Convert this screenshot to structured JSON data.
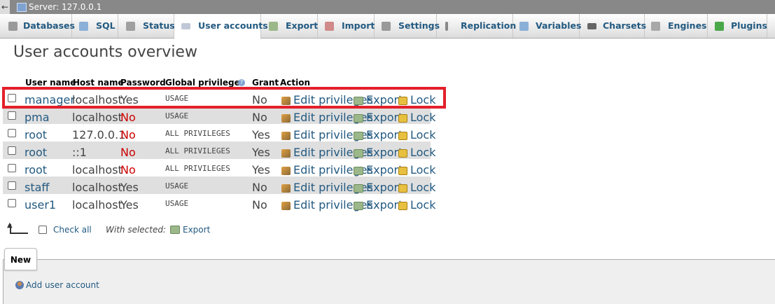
{
  "topbar": {
    "back": "←",
    "server_label": "Server: 127.0.0.1"
  },
  "tabs": [
    {
      "label": "Databases",
      "icon": "databases-icon"
    },
    {
      "label": "SQL",
      "icon": "sql-icon"
    },
    {
      "label": "Status",
      "icon": "status-icon"
    },
    {
      "label": "User accounts",
      "icon": "user-accounts-icon",
      "active": true
    },
    {
      "label": "Export",
      "icon": "export-icon"
    },
    {
      "label": "Import",
      "icon": "import-icon"
    },
    {
      "label": "Settings",
      "icon": "settings-icon"
    },
    {
      "label": "Replication",
      "icon": "replication-icon"
    },
    {
      "label": "Variables",
      "icon": "variables-icon"
    },
    {
      "label": "Charsets",
      "icon": "charsets-icon"
    },
    {
      "label": "Engines",
      "icon": "engines-icon"
    },
    {
      "label": "Plugins",
      "icon": "plugins-icon"
    }
  ],
  "page_title": "User accounts overview",
  "table": {
    "headers": {
      "user": "User name",
      "host": "Host name",
      "password": "Password",
      "privs": "Global privileges",
      "grant": "Grant",
      "action": "Action"
    },
    "rows": [
      {
        "user": "manager",
        "host": "localhost",
        "password": "Yes",
        "privs": "USAGE",
        "grant": "No"
      },
      {
        "user": "pma",
        "host": "localhost",
        "password": "No",
        "privs": "USAGE",
        "grant": "No"
      },
      {
        "user": "root",
        "host": "127.0.0.1",
        "password": "No",
        "privs": "ALL PRIVILEGES",
        "grant": "Yes"
      },
      {
        "user": "root",
        "host": "::1",
        "password": "No",
        "privs": "ALL PRIVILEGES",
        "grant": "Yes"
      },
      {
        "user": "root",
        "host": "localhost",
        "password": "No",
        "privs": "ALL PRIVILEGES",
        "grant": "Yes"
      },
      {
        "user": "staff",
        "host": "localhost",
        "password": "Yes",
        "privs": "USAGE",
        "grant": "No"
      },
      {
        "user": "user1",
        "host": "localhost",
        "password": "Yes",
        "privs": "USAGE",
        "grant": "No"
      }
    ],
    "actions": {
      "edit": "Edit privileges",
      "export": "Export",
      "lock": "Lock"
    }
  },
  "bulk": {
    "check_all": "Check all",
    "with_selected": "With selected:",
    "export": "Export"
  },
  "new_section": {
    "tab_label": "New",
    "add_user": "Add user account"
  },
  "colors": {
    "link": "#235a81",
    "highlight": "#e3202a",
    "password_no": "#cc0000"
  }
}
